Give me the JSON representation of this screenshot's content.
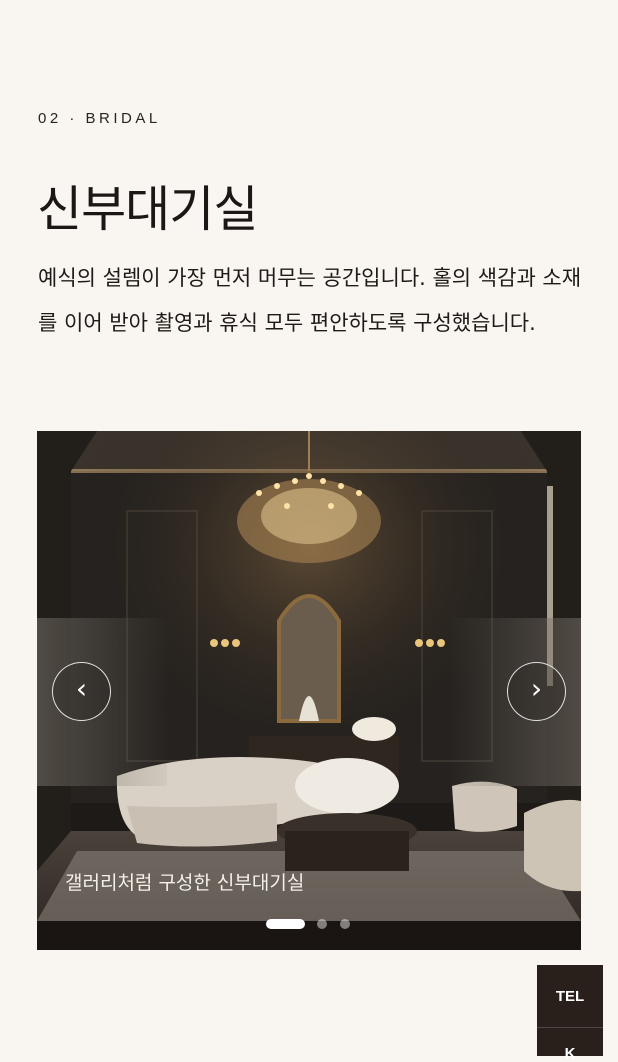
{
  "section": {
    "eyebrow": "02 · BRIDAL",
    "title": "신부대기실",
    "description": "예식의 설렘이 가장 먼저 머무는 공간입니다. 홀의 색감과 소재를 이어 받아 촬영과 휴식 모두 편안하도록 구성했습니다."
  },
  "slider": {
    "prev_label": "‹",
    "next_label": "›",
    "caption": "갤러리처럼 구성한 신부대기실",
    "slide_count": 3,
    "active_index": 0
  },
  "side_bar": {
    "tel_label": "TEL",
    "next_label": "K"
  },
  "colors": {
    "background": "#f9f6f2",
    "text": "#1f1a17",
    "side_bar": "#2a201b"
  }
}
